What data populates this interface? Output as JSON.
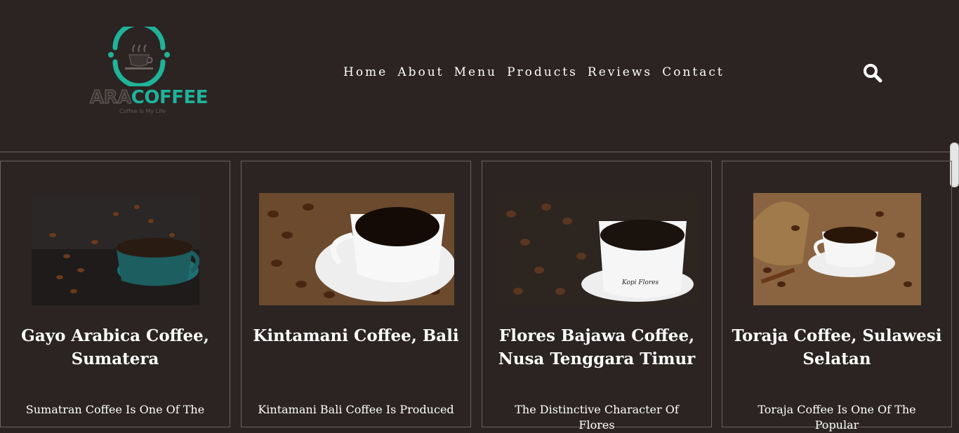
{
  "logo": {
    "part1": "ARA",
    "part2": "COFFEE",
    "tagline": "Coffee Is My Life"
  },
  "nav": [
    "Home",
    "About",
    "Menu",
    "Products",
    "Reviews",
    "Contact"
  ],
  "products": [
    {
      "title": "Gayo Arabica Coffee, Sumatera",
      "text": "Sumatran Coffee Is One Of The"
    },
    {
      "title": "Kintamani Coffee, Bali",
      "text": "Kintamani Bali Coffee Is Produced"
    },
    {
      "title": "Flores Bajawa Coffee, Nusa Tenggara Timur",
      "text": "The Distinctive Character Of Flores",
      "cup_label": "Kopi Flores"
    },
    {
      "title": "Toraja Coffee, Sulawesi Selatan",
      "text": "Toraja Coffee Is One Of The Popular"
    }
  ],
  "colors": {
    "background": "#2b2422",
    "accent": "#1fb39a"
  },
  "icons": {
    "search": "search-icon"
  }
}
